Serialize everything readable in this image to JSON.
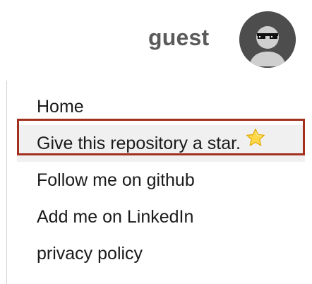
{
  "header": {
    "username": "guest",
    "avatar_icon": "avatar-sunglasses-icon"
  },
  "menu": {
    "items": [
      {
        "label": "Home"
      },
      {
        "label": "Give this repository a star.",
        "icon": "star-icon",
        "highlighted": true
      },
      {
        "label": "Follow me on github"
      },
      {
        "label": "Add me on LinkedIn"
      },
      {
        "label": "privacy policy"
      }
    ]
  },
  "colors": {
    "username": "#5a5a5a",
    "avatar_bg": "#4d4d4d",
    "highlight_border": "#a3301f",
    "highlight_bg": "#f0f0f0",
    "star_fill": "#ffd84a"
  }
}
